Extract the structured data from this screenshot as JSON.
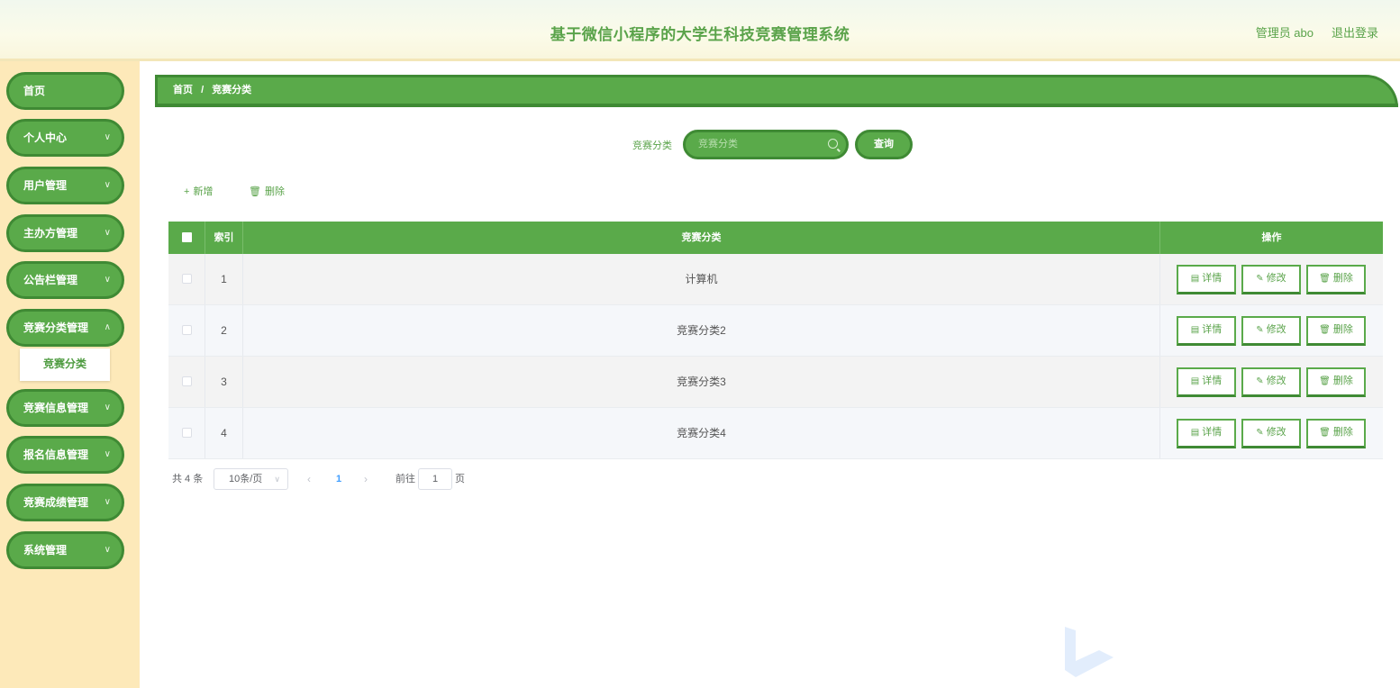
{
  "header": {
    "title": "基于微信小程序的大学生科技竞赛管理系统",
    "user": "管理员 abo",
    "logout": "退出登录"
  },
  "sidebar": {
    "items": [
      {
        "label": "首页",
        "has_children": false
      },
      {
        "label": "个人中心",
        "has_children": true
      },
      {
        "label": "用户管理",
        "has_children": true
      },
      {
        "label": "主办方管理",
        "has_children": true
      },
      {
        "label": "公告栏管理",
        "has_children": true
      },
      {
        "label": "竞赛分类管理",
        "has_children": true
      },
      {
        "label": "竞赛信息管理",
        "has_children": true
      },
      {
        "label": "报名信息管理",
        "has_children": true
      },
      {
        "label": "竞赛成绩管理",
        "has_children": true
      },
      {
        "label": "系统管理",
        "has_children": true
      }
    ],
    "open_submenu": {
      "label": "竞赛分类"
    }
  },
  "breadcrumb": {
    "home": "首页",
    "separator": "/",
    "current": "竞赛分类"
  },
  "search": {
    "label": "竞赛分类",
    "placeholder": "竞赛分类",
    "value": "",
    "button": "查询"
  },
  "toolbar": {
    "add": "新增",
    "delete": "删除"
  },
  "table": {
    "headers": {
      "index": "索引",
      "name": "竞赛分类",
      "actions": "操作"
    },
    "rows": [
      {
        "index": "1",
        "name": "计算机"
      },
      {
        "index": "2",
        "name": "竞赛分类2"
      },
      {
        "index": "3",
        "name": "竞赛分类3"
      },
      {
        "index": "4",
        "name": "竞赛分类4"
      }
    ],
    "actions": {
      "detail": "详情",
      "edit": "修改",
      "delete": "删除"
    }
  },
  "pagination": {
    "total": "共 4 条",
    "page_size": "10条/页",
    "current_page": "1",
    "goto_label": "前往",
    "goto_value": "1",
    "goto_unit": "页"
  },
  "colors": {
    "primary": "#5aaa4a",
    "primary_dark": "#3f8a34",
    "sidebar_bg": "#fde9b9",
    "link": "#409eff"
  }
}
